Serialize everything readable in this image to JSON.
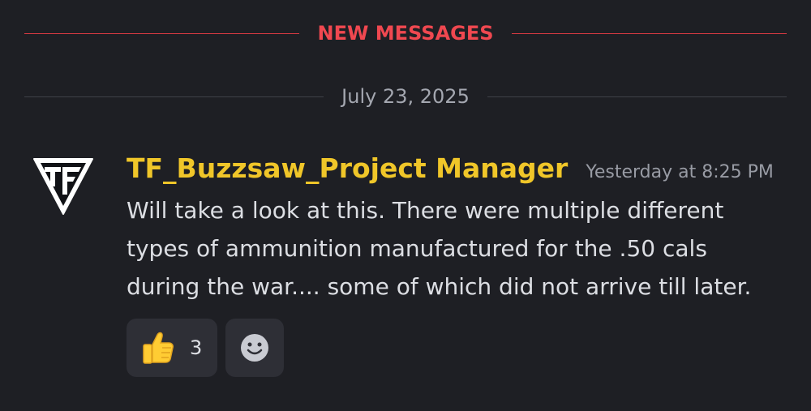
{
  "new_messages_divider": {
    "label": "NEW MESSAGES"
  },
  "date_divider": {
    "label": "July 23, 2025"
  },
  "message": {
    "username": "TF_Buzzsaw_Project Manager",
    "timestamp": "Yesterday at 8:25 PM",
    "content": "Will take a look at this.  There were multiple different\ntypes of ammunition manufactured for the .50 cals\nduring the war.... some of which did not arrive till later.",
    "avatar_icon": "tf-logo-icon",
    "reactions": [
      {
        "emoji": "thumbs-up-icon",
        "count": "3"
      }
    ],
    "add_reaction_icon": "smiley-icon"
  },
  "colors": {
    "background": "#1e1f24",
    "new_messages": "#f04850",
    "username": "#f0c629",
    "reaction_bg": "#2e2f36"
  }
}
